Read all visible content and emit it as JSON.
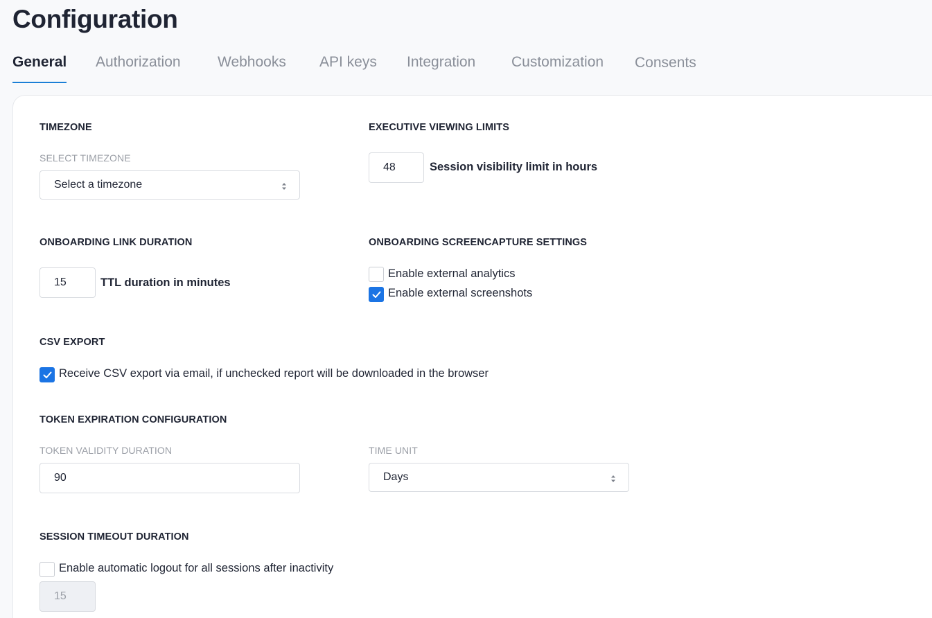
{
  "page_title": "Configuration",
  "tabs": [
    {
      "label": "General",
      "active": true
    },
    {
      "label": "Authorization",
      "active": false
    },
    {
      "label": "Webhooks",
      "active": false
    },
    {
      "label": "API keys",
      "active": false
    },
    {
      "label": "Integration",
      "active": false
    },
    {
      "label": "Customization",
      "active": false
    },
    {
      "label": "Consents",
      "active": false
    }
  ],
  "timezone": {
    "title": "TIMEZONE",
    "select_label": "SELECT TIMEZONE",
    "select_value": "Select a timezone"
  },
  "executive_viewing": {
    "title": "EXECUTIVE VIEWING LIMITS",
    "hours_value": "48",
    "hours_label": "Session visibility limit in hours"
  },
  "onboarding_link": {
    "title": "ONBOARDING LINK DURATION",
    "ttl_value": "15",
    "ttl_label": "TTL duration in minutes"
  },
  "screencapture": {
    "title": "ONBOARDING SCREENCAPTURE SETTINGS",
    "analytics_label": "Enable external analytics",
    "analytics_checked": false,
    "screenshots_label": "Enable external screenshots",
    "screenshots_checked": true
  },
  "csv_export": {
    "title": "CSV EXPORT",
    "email_label": "Receive CSV export via email, if unchecked report will be downloaded in the browser",
    "email_checked": true
  },
  "token_expiration": {
    "title": "TOKEN EXPIRATION CONFIGURATION",
    "validity_label": "TOKEN VALIDITY DURATION",
    "validity_value": "90",
    "unit_label": "TIME UNIT",
    "unit_value": "Days"
  },
  "session_timeout": {
    "title": "SESSION TIMEOUT DURATION",
    "logout_label": "Enable automatic logout for all sessions after inactivity",
    "logout_checked": false,
    "minutes_value": "15"
  },
  "colors": {
    "accent": "#1b7fd6",
    "checkbox_checked": "#1b74e4",
    "muted_text": "#9a9ea6"
  },
  "icons": {
    "select_indicator": "sort-arrows-icon",
    "checkmark": "checkmark-icon"
  }
}
